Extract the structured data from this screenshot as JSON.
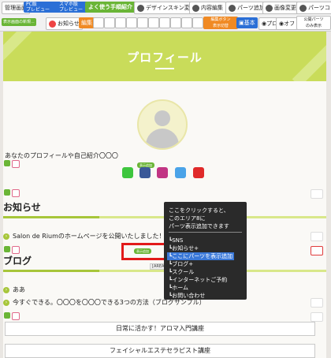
{
  "toolbar": {
    "admin_label": "管理画面",
    "pc_preview_top": "PC版",
    "pc_preview": "プレビュー",
    "sp_preview_top": "スマホ版",
    "sp_preview": "プレビュー",
    "guide": "よく使う手順紹介",
    "design_change": "デザインスキン変更",
    "content_edit": "内容編集",
    "parts_add": "パーツ追加",
    "image_change": "画像変更",
    "parts_copy": "パーツコピー",
    "post_label": "表示画面の新規...",
    "notice": "お知らせ",
    "edit_label": "編集",
    "edit_button_top": "編集ボタン",
    "edit_button_bottom": "表示切替",
    "basic": "基本",
    "pro": "プロ",
    "off": "オフ",
    "public_top": "公開パーツ",
    "public_bottom": "のみ表示"
  },
  "profile": {
    "title": "プロフィール",
    "intro": "あなたのプロフィールや自己紹介〇〇〇",
    "add_label": "表示追加"
  },
  "news": {
    "title": "お知らせ",
    "item": "Salon de Riumのホームページを公開いたしました！"
  },
  "blog": {
    "title": "ブログ",
    "items": [
      "ああ",
      "今すぐできる。〇〇〇を〇〇〇できる3つの方法（ブログサンプル）"
    ]
  },
  "area_label": "[AREA 8]",
  "courses": [
    "日常に活かす！アロマ入門講座",
    "フェイシャルエステセラピスト講座"
  ],
  "popup": {
    "hint": [
      "ここをクリックすると、",
      "このエリア8に",
      "パーツ表示追加できます"
    ],
    "options": [
      "┗SNS",
      "┗お知らせ+",
      "┗ここにパーツを表示追加",
      "┗ブログ+",
      "┗スクール",
      "┗インターネットご予約",
      "┗ホーム",
      "┗お問い合わせ"
    ]
  },
  "colors": {
    "accent": "#c9dc5a",
    "brand_blue": "#2b6fd6",
    "highlight_red": "#e21a1a"
  }
}
